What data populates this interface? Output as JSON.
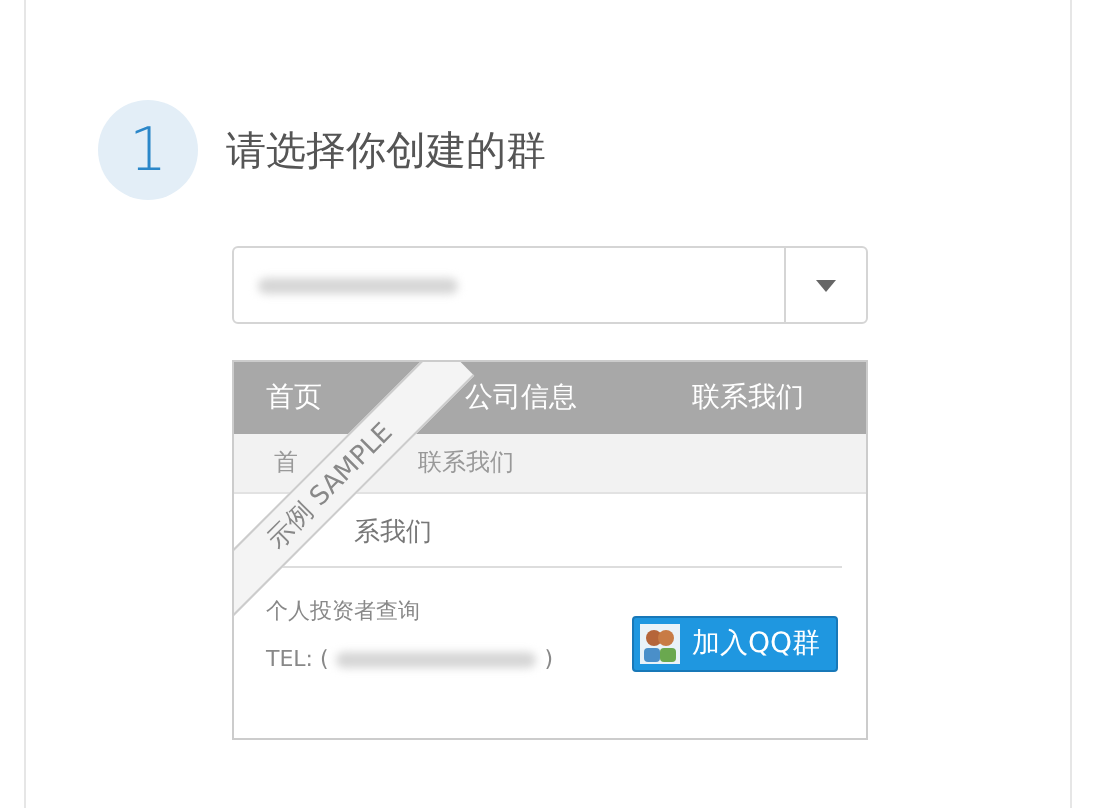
{
  "step": {
    "number": "1",
    "title": "请选择你创建的群"
  },
  "select": {
    "value_blurred": true
  },
  "preview": {
    "ribbon": "示例 SAMPLE",
    "nav": [
      {
        "label": "首页"
      },
      {
        "label": "公司信息"
      },
      {
        "label": "联系我们"
      }
    ],
    "breadcrumb": [
      {
        "label": "首"
      },
      {
        "label": "联系我们"
      }
    ],
    "heading": "系我们",
    "contact_title": "个人投资者查询",
    "tel_label": "TEL: (",
    "tel_end": ")",
    "join_button": "加入QQ群"
  }
}
